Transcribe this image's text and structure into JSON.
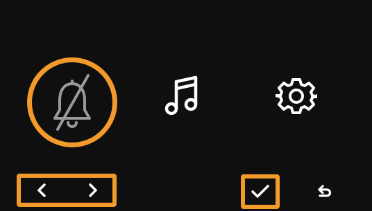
{
  "screen": {
    "background": "#0f0f0f",
    "accent": "#f39a2b",
    "icon_color": "#ffffff",
    "inactive_icon_color": "#9a9a9a"
  },
  "menu": {
    "items": [
      {
        "icon": "bell-muted-icon",
        "selected": true
      },
      {
        "icon": "music-note-icon",
        "selected": false
      },
      {
        "icon": "gear-icon",
        "selected": false
      }
    ]
  },
  "controls": {
    "prev": {
      "icon": "chevron-left-icon"
    },
    "next": {
      "icon": "chevron-right-icon"
    },
    "confirm": {
      "icon": "checkmark-icon"
    },
    "back": {
      "icon": "back-arrow-icon"
    }
  }
}
